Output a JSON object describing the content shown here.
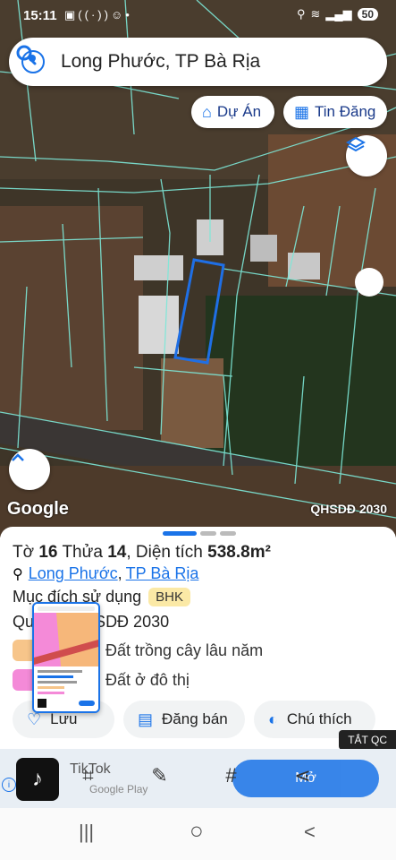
{
  "status_bar": {
    "time": "15:11",
    "left_icons": [
      "gallery-icon",
      "nfc-icon",
      "app-icon",
      "dot-icon"
    ],
    "right_icons": [
      "location-icon",
      "wifi-icon",
      "signal-icon",
      "signal-icon"
    ],
    "battery": "50"
  },
  "search": {
    "text": "Long Phước, TP Bà Rịa"
  },
  "chips": {
    "du_an": "Dự Án",
    "tin_dang": "Tin Đăng"
  },
  "map": {
    "google_label": "Google",
    "layer_label": "QHSDĐ 2030"
  },
  "parcel": {
    "to_prefix": "Tờ",
    "to_value": "16",
    "thua_prefix": "Thửa",
    "thua_value": "14",
    "dientich_prefix": ", Diện tích",
    "dientich_value": "538.8m²",
    "location_1": "Long Phước",
    "location_sep": ",",
    "location_2": "TP Bà Rịa",
    "purpose_label": "Mục đích sử dụng",
    "purpose_code": "BHK",
    "plan_label": "Quy hoạch SDĐ 2030",
    "legend": [
      {
        "label": "Đất trồng cây lâu năm",
        "color": "#f7c58a"
      },
      {
        "label": "Đất ở đô thị",
        "color": "#f48ad8"
      }
    ]
  },
  "actions": {
    "first": "Lưu",
    "dang_ban": "Đăng bán",
    "chu_thich": "Chú thích"
  },
  "ad": {
    "close_label": "TẮT QC",
    "app_name": "TikTok",
    "store": "Google Play",
    "button": "Mở"
  },
  "nav": {
    "recent": "|||",
    "home": "○",
    "back": "<"
  }
}
